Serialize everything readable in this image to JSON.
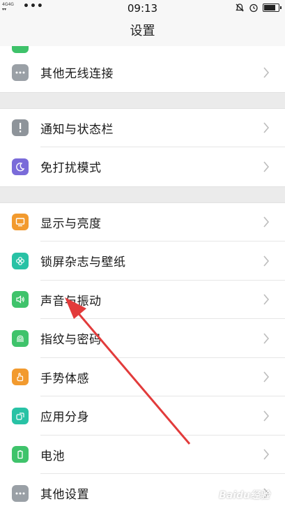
{
  "status_bar": {
    "network": "4G 4G",
    "dots": "•••",
    "time": "09:13",
    "icons": [
      "bell-muted-icon",
      "alarm-icon",
      "battery-icon"
    ]
  },
  "title": "设置",
  "groups": [
    {
      "items": [
        {
          "label": "其他无线连接",
          "icon": "more-dots-icon",
          "color": "#9aa0a6"
        }
      ]
    },
    {
      "items": [
        {
          "label": "通知与状态栏",
          "icon": "exclamation-icon",
          "color": "#8e949a"
        },
        {
          "label": "免打扰模式",
          "icon": "moon-icon",
          "color": "#7a6bd9"
        }
      ]
    },
    {
      "items": [
        {
          "label": "显示与亮度",
          "icon": "display-icon",
          "color": "#f29a2e"
        },
        {
          "label": "锁屏杂志与壁纸",
          "icon": "flower-icon",
          "color": "#28c2a5"
        },
        {
          "label": "声音与振动",
          "icon": "speaker-icon",
          "color": "#3fc36b"
        },
        {
          "label": "指纹与密码",
          "icon": "fingerprint-icon",
          "color": "#3fc36b"
        },
        {
          "label": "手势体感",
          "icon": "hand-gesture-icon",
          "color": "#f29a2e"
        },
        {
          "label": "应用分身",
          "icon": "app-clone-icon",
          "color": "#28c2a5"
        },
        {
          "label": "电池",
          "icon": "battery-icon",
          "color": "#3fc36b"
        },
        {
          "label": "其他设置",
          "icon": "more-dots-icon",
          "color": "#9aa0a6"
        }
      ]
    }
  ],
  "watermark": "Baidu经验"
}
